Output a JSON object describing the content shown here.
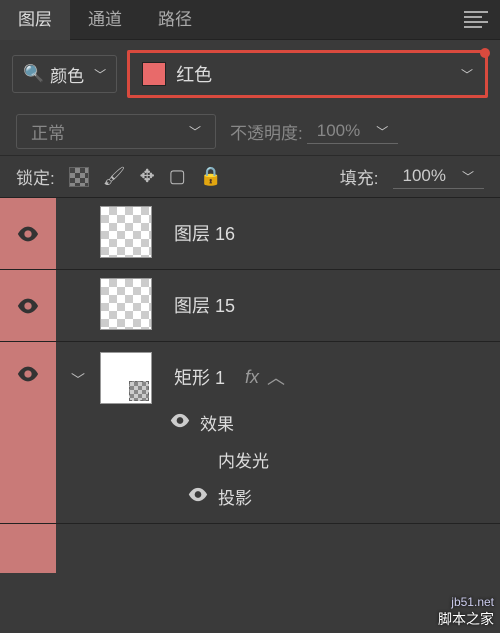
{
  "tabs": {
    "layers": "图层",
    "channels": "通道",
    "paths": "路径"
  },
  "filter": {
    "kind": "颜色",
    "color_name": "红色",
    "swatch": "#e86a6a"
  },
  "blend": {
    "mode": "正常",
    "opacity_label": "不透明度:",
    "opacity_value": "100%"
  },
  "lock": {
    "label": "锁定:",
    "fill_label": "填充:",
    "fill_value": "100%"
  },
  "layers": [
    {
      "name": "图层 16"
    },
    {
      "name": "图层 15"
    },
    {
      "name": "矩形 1",
      "fx_label": "fx",
      "effects_label": "效果",
      "effects": [
        "内发光",
        "投影"
      ]
    }
  ],
  "watermark": {
    "url": "jb51.net",
    "name": "脚本之家"
  }
}
